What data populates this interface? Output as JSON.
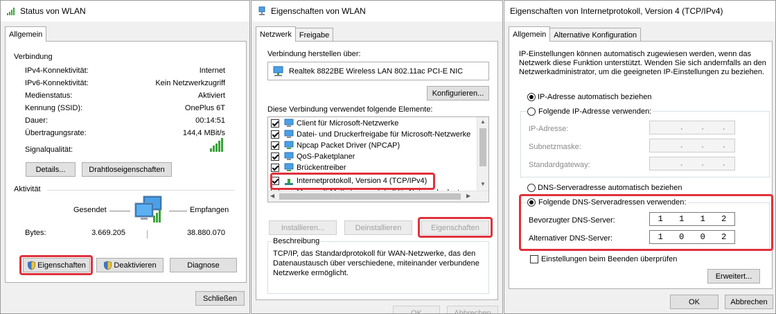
{
  "win1": {
    "title": "Status von WLAN",
    "tab": "Allgemein",
    "connection_header": "Verbindung",
    "rows": [
      {
        "label": "IPv4-Konnektivität:",
        "value": "Internet"
      },
      {
        "label": "IPv6-Konnektivität:",
        "value": "Kein Netzwerkzugriff"
      },
      {
        "label": "Medienstatus:",
        "value": "Aktiviert"
      },
      {
        "label": "Kennung (SSID):",
        "value": "OnePlus 6T"
      },
      {
        "label": "Dauer:",
        "value": "00:14:51"
      },
      {
        "label": "Übertragungsrate:",
        "value": "144,4 MBit/s"
      }
    ],
    "signal_label": "Signalqualität:",
    "details_btn": "Details...",
    "wireless_props_btn": "Drahtloseigenschaften",
    "activity_header": "Aktivität",
    "sent_label": "Gesendet",
    "received_label": "Empfangen",
    "bytes_label": "Bytes:",
    "bytes_sent": "3.669.205",
    "bytes_received": "38.880.070",
    "properties_btn": "Eigenschaften",
    "deactivate_btn": "Deaktivieren",
    "diagnose_btn": "Diagnose",
    "close_btn": "Schließen"
  },
  "win2": {
    "title": "Eigenschaften von WLAN",
    "tabs": [
      "Netzwerk",
      "Freigabe"
    ],
    "connect_using_label": "Verbindung herstellen über:",
    "adapter_name": "Realtek 8822BE Wireless LAN 802.11ac PCI-E NIC",
    "configure_btn": "Konfigurieren...",
    "items_label": "Diese Verbindung verwendet folgende Elemente:",
    "items": [
      {
        "label": "Client für Microsoft-Netzwerke",
        "checked": true
      },
      {
        "label": "Datei- und Druckerfreigabe für Microsoft-Netzwerke",
        "checked": true
      },
      {
        "label": "Npcap Packet Driver (NPCAP)",
        "checked": true
      },
      {
        "label": "QoS-Paketplaner",
        "checked": true
      },
      {
        "label": "Brückentreiber",
        "checked": true
      },
      {
        "label": "Internetprotokoll, Version 4 (TCP/IPv4)",
        "checked": true
      },
      {
        "label": "Microsoft-Multiplexorprotokoll für Netzwerkadapter",
        "checked": false
      }
    ],
    "install_btn": "Installieren...",
    "uninstall_btn": "Deinstallieren",
    "properties_btn": "Eigenschaften",
    "description_header": "Beschreibung",
    "description_text": [
      "TCP/IP, das Standardprotokoll für WAN-Netzwerke, das den",
      "Datenaustausch über verschiedene, miteinander verbundene",
      "Netzwerke ermöglicht."
    ],
    "ok_btn": "OK",
    "cancel_btn": "Abbrechen"
  },
  "win3": {
    "title": "Eigenschaften von Internetprotokoll, Version 4 (TCP/IPv4)",
    "tabs": [
      "Allgemein",
      "Alternative Konfiguration"
    ],
    "intro": [
      "IP-Einstellungen können automatisch zugewiesen werden, wenn das",
      "Netzwerk diese Funktion unterstützt. Wenden Sie sich andernfalls an den",
      "Netzwerkadministrator, um die geeigneten IP-Einstellungen zu beziehen."
    ],
    "ip_auto": "IP-Adresse automatisch beziehen",
    "ip_manual": "Folgende IP-Adresse verwenden:",
    "ip_address_label": "IP-Adresse:",
    "subnet_label": "Subnetzmaske:",
    "gateway_label": "Standardgateway:",
    "empty_ip": [
      ".",
      ".",
      "."
    ],
    "dns_auto": "DNS-Serveradresse automatisch beziehen",
    "dns_manual": "Folgende DNS-Serveradressen verwenden:",
    "preferred_dns_label": "Bevorzugter DNS-Server:",
    "preferred_dns": [
      "1",
      "1",
      "1",
      "2"
    ],
    "alternate_dns_label": "Alternativer DNS-Server:",
    "alternate_dns": [
      "1",
      "0",
      "0",
      "2"
    ],
    "validate_label": "Einstellungen beim Beenden überprüfen",
    "advanced_btn": "Erweitert...",
    "ok_btn": "OK",
    "cancel_btn": "Abbrechen"
  },
  "colors": {
    "highlight": "#e0313b",
    "signal": "#3aa33a"
  }
}
